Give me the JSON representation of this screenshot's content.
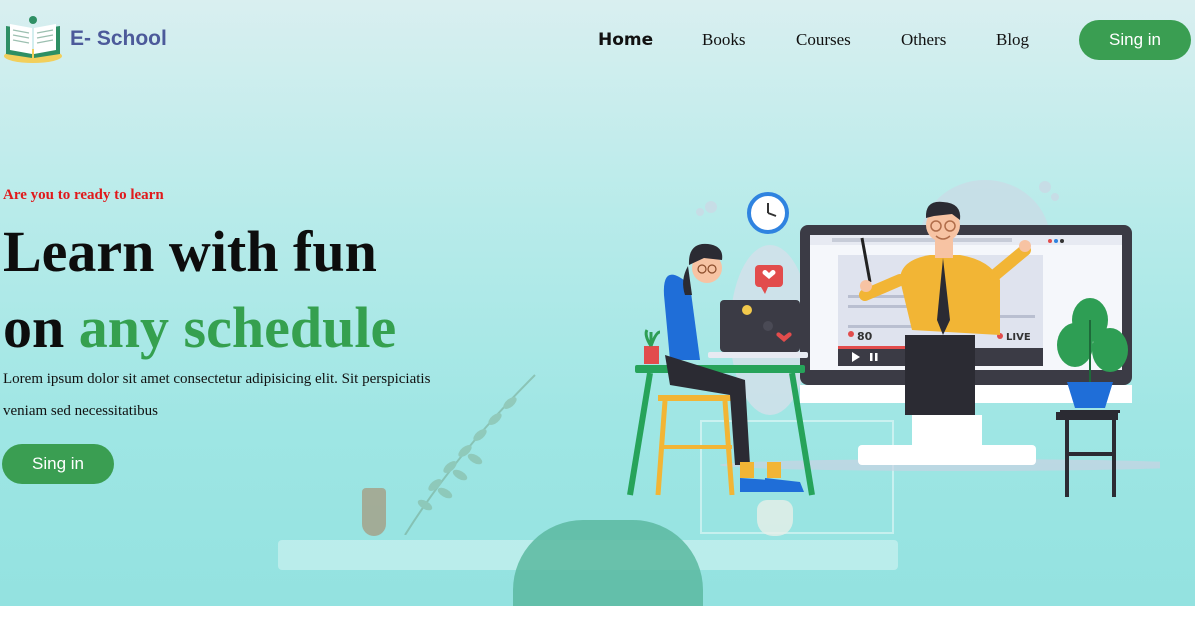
{
  "brand": {
    "name": "E- School",
    "logo_icon": "open-book-icon"
  },
  "nav": {
    "items": [
      {
        "label": "Home",
        "active": true
      },
      {
        "label": "Books",
        "active": false
      },
      {
        "label": "Courses",
        "active": false
      },
      {
        "label": "Others",
        "active": false
      },
      {
        "label": "Blog",
        "active": false
      }
    ],
    "signin_label": "Sing in"
  },
  "hero": {
    "eyebrow": "Are you to ready to learn",
    "headline_line1": "Learn with fun",
    "headline_line2_prefix": "on ",
    "headline_line2_accent": "any schedule",
    "lead": "Lorem ipsum dolor sit amet consectetur adipisicing elit. Sit perspiciatis veniam sed necessitatibus",
    "cta_label": "Sing in"
  },
  "illustration": {
    "viewer_count": "80",
    "live_label": "LIVE"
  },
  "colors": {
    "accent_green": "#3a9e52",
    "eyebrow_red": "#e0191b",
    "brand_blue": "#4c5a9a"
  }
}
